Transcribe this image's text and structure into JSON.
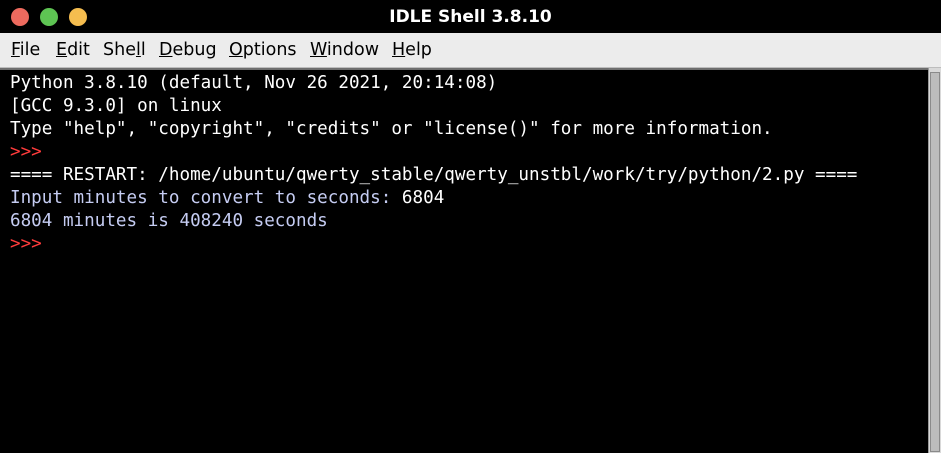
{
  "window": {
    "title": "IDLE Shell 3.8.10"
  },
  "menu": {
    "items": [
      {
        "pre": "",
        "key": "F",
        "post": "ile"
      },
      {
        "pre": "",
        "key": "E",
        "post": "dit"
      },
      {
        "pre": "She",
        "key": "l",
        "post": "l"
      },
      {
        "pre": "",
        "key": "D",
        "post": "ebug"
      },
      {
        "pre": "",
        "key": "O",
        "post": "ptions"
      },
      {
        "pre": "",
        "key": "W",
        "post": "indow"
      },
      {
        "pre": "",
        "key": "H",
        "post": "elp"
      }
    ]
  },
  "shell": {
    "lines": [
      "Python 3.8.10 (default, Nov 26 2021, 20:14:08)",
      "[GCC 9.3.0] on linux",
      "Type \"help\", \"copyright\", \"credits\" or \"license()\" for more information.",
      ">>> ",
      "==== RESTART: /home/ubuntu/qwerty_stable/qwerty_unstbl/work/try/python/2.py ====",
      "Input minutes to convert to seconds: ",
      "6804 minutes is 408240 seconds",
      ">>> "
    ],
    "user_input": "6804"
  },
  "colors": {
    "title_bar": "#000000",
    "close": "#ed6a5e",
    "maximize": "#5ec453",
    "minimize": "#f5bd4f",
    "menu_bg": "#ececec",
    "shell_bg": "#000000",
    "stdout": "#c5ccf2",
    "prompt": "#ff3b3b",
    "output": "#ffffff"
  }
}
